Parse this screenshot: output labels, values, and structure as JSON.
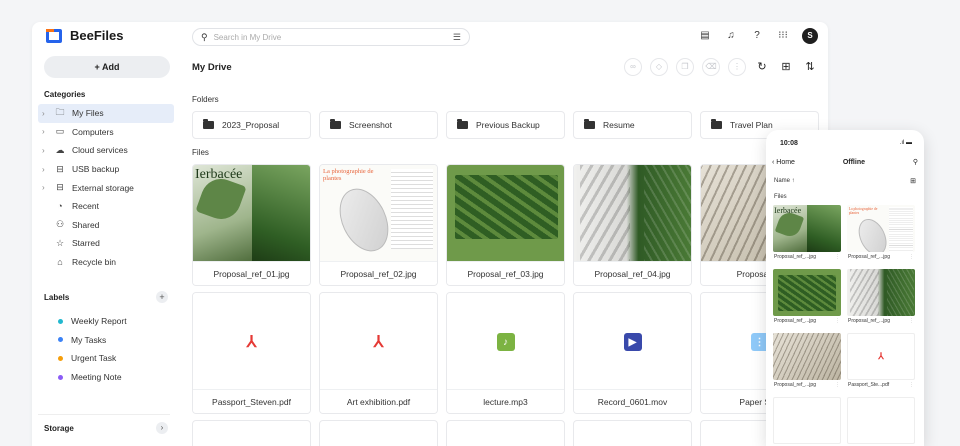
{
  "app": {
    "name": "BeeFiles"
  },
  "sidebar": {
    "add_label": "+ Add",
    "categories_title": "Categories",
    "items": [
      {
        "label": "My Files",
        "icon": "folder-icon",
        "chev": true,
        "active": true
      },
      {
        "label": "Computers",
        "icon": "monitor-icon",
        "chev": true
      },
      {
        "label": "Cloud services",
        "icon": "cloud-icon",
        "chev": true
      },
      {
        "label": "USB backup",
        "icon": "usb-icon",
        "chev": true
      },
      {
        "label": "External storage",
        "icon": "drive-icon",
        "chev": true
      },
      {
        "label": "Recent",
        "icon": "clock-icon"
      },
      {
        "label": "Shared",
        "icon": "people-icon"
      },
      {
        "label": "Starred",
        "icon": "star-icon"
      },
      {
        "label": "Recycle bin",
        "icon": "trash-icon"
      }
    ],
    "labels_title": "Labels",
    "labels": [
      {
        "label": "Weekly Report",
        "color": "#22b8cf"
      },
      {
        "label": "My Tasks",
        "color": "#3b82f6"
      },
      {
        "label": "Urgent Task",
        "color": "#f59e0b"
      },
      {
        "label": "Meeting Note",
        "color": "#8b5cf6"
      }
    ],
    "storage_title": "Storage"
  },
  "search": {
    "placeholder": "Search in My Drive",
    "value": ""
  },
  "header": {
    "avatar_initial": "S"
  },
  "main": {
    "title": "My Drive",
    "folders_title": "Folders",
    "files_title": "Files",
    "folders": [
      "2023_Proposal",
      "Screenshot",
      "Previous Backup",
      "Resume",
      "Travel Plan"
    ],
    "files": [
      {
        "name": "Proposal_ref_01.jpg",
        "kind": "img1",
        "thumb_text": "Ierbacée"
      },
      {
        "name": "Proposal_ref_02.jpg",
        "kind": "img2",
        "thumb_text": "La photographie de plantes"
      },
      {
        "name": "Proposal_ref_03.jpg",
        "kind": "img3"
      },
      {
        "name": "Proposal_ref_04.jpg",
        "kind": "img4"
      },
      {
        "name": "Proposal_re",
        "kind": "img5"
      },
      {
        "name": "Passport_Steven.pdf",
        "kind": "pdf"
      },
      {
        "name": "Art exhibition.pdf",
        "kind": "pdf"
      },
      {
        "name": "lecture.mp3",
        "kind": "audio"
      },
      {
        "name": "Record_0601.mov",
        "kind": "video"
      },
      {
        "name": "Paper Sub",
        "kind": "zip"
      }
    ]
  },
  "phone": {
    "time": "10:08",
    "signal": ".ıl ▬",
    "back_label": "Home",
    "title": "Offline",
    "sort_label": "Name ↑",
    "files_title": "Files",
    "files": [
      {
        "name": "Proposal_ref_...jpg",
        "kind": "img1"
      },
      {
        "name": "Proposal_ref_...jpg",
        "kind": "img2"
      },
      {
        "name": "Proposal_ref_...jpg",
        "kind": "img3"
      },
      {
        "name": "Proposal_ref_...jpg",
        "kind": "img4"
      },
      {
        "name": "Proposal_ref_...jpg",
        "kind": "img5"
      },
      {
        "name": "Passport_Ste...pdf",
        "kind": "pdf"
      }
    ]
  },
  "colors": {
    "accent": "#2563eb",
    "active_bg": "#e6edf9",
    "pdf": "#e53935",
    "audio": "#7cb342",
    "video": "#3949ab",
    "zip": "#90caf9"
  }
}
